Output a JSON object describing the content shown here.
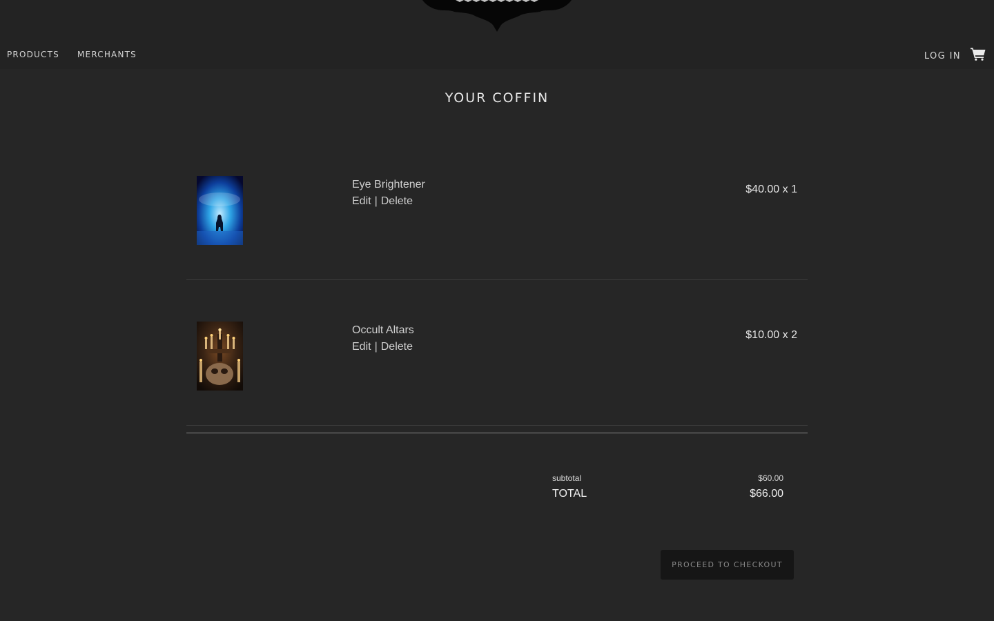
{
  "header": {
    "nav": [
      {
        "label": "PRODUCTS"
      },
      {
        "label": "MERCHANTS"
      }
    ],
    "login_label": "LOG IN",
    "cart_icon": "shopping-cart-icon",
    "logo_icon": "bat-logo-icon"
  },
  "page": {
    "title": "YOUR COFFIN"
  },
  "cart": {
    "items": [
      {
        "name": "Eye Brightener",
        "edit_label": "Edit",
        "separator": "|",
        "delete_label": "Delete",
        "price_qty": "$40.00 x 1",
        "thumb": "blue-mist-figure-image"
      },
      {
        "name": "Occult Altars",
        "edit_label": "Edit",
        "separator": "|",
        "delete_label": "Delete",
        "price_qty": "$10.00 x 2",
        "thumb": "candle-altar-image"
      }
    ],
    "subtotal_label": "subtotal",
    "subtotal_value": "$60.00",
    "total_label": "TOTAL",
    "total_value": "$66.00",
    "checkout_label": "PROCEED TO CHECKOUT"
  },
  "colors": {
    "background": "#262626",
    "header": "#232323",
    "button": "#161616"
  }
}
